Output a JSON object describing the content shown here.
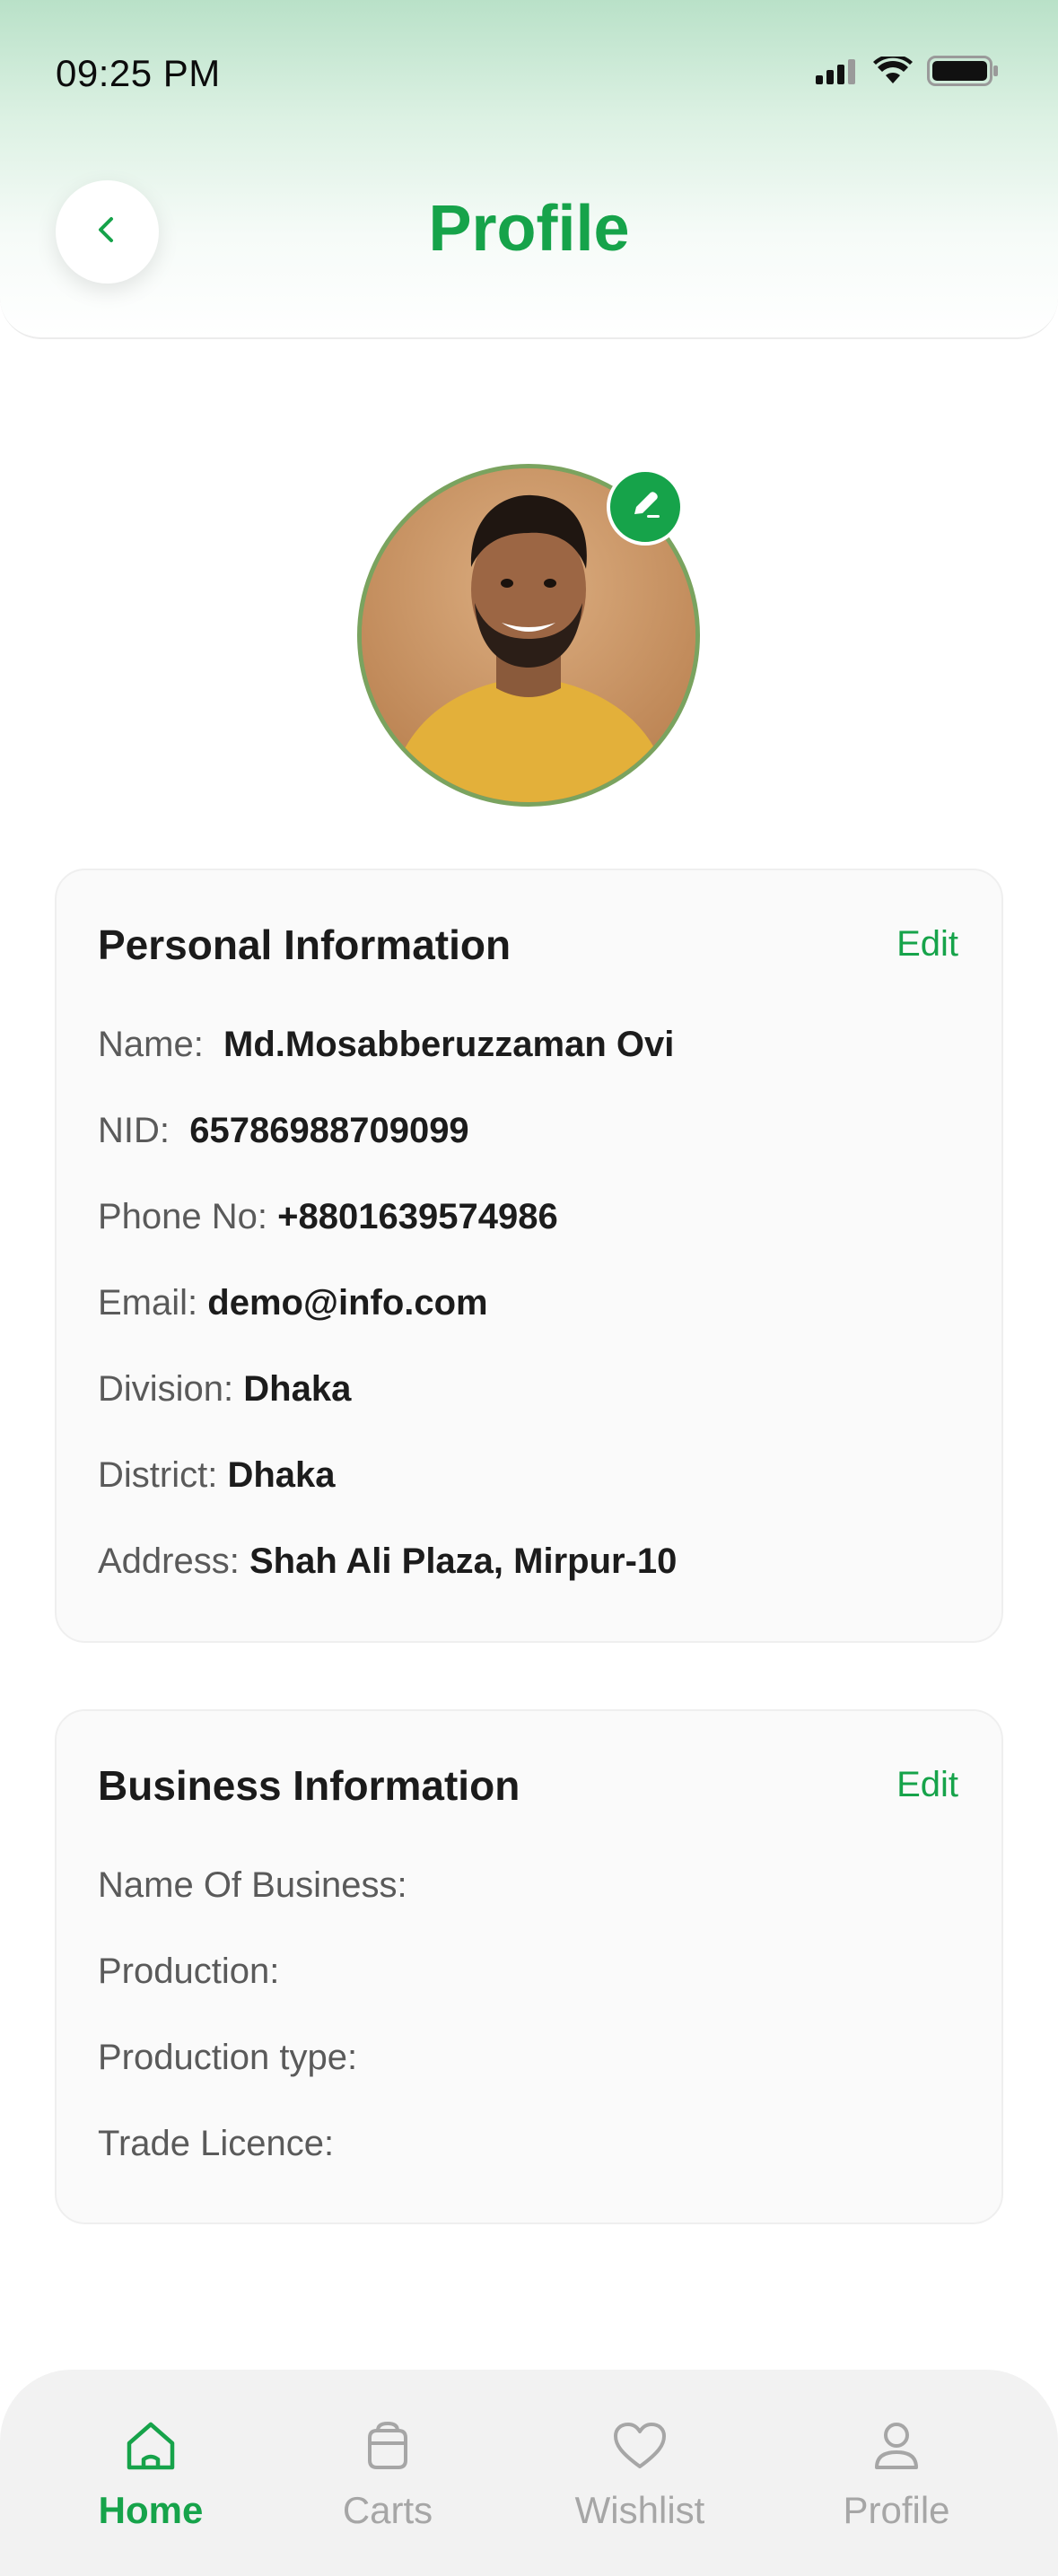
{
  "status_bar": {
    "time": "09:25 PM"
  },
  "header": {
    "title": "Profile",
    "back_icon": "chevron-left-icon"
  },
  "avatar": {
    "edit_icon": "pencil-icon"
  },
  "personal_info": {
    "title": "Personal Information",
    "edit_label": "Edit",
    "rows": [
      {
        "label": "Name:",
        "value": "Md.Mosabberuzzaman Ovi"
      },
      {
        "label": "NID:",
        "value": "65786988709099"
      },
      {
        "label": "Phone No:",
        "value": "+8801639574986"
      },
      {
        "label": "Email:",
        "value": "demo@info.com"
      },
      {
        "label": "Division:",
        "value": "Dhaka"
      },
      {
        "label": "District:",
        "value": "Dhaka"
      },
      {
        "label": "Address:",
        "value": "Shah Ali Plaza, Mirpur-10"
      }
    ]
  },
  "business_info": {
    "title": "Business Information",
    "edit_label": "Edit",
    "rows": [
      {
        "label": "Name Of Business:",
        "value": ""
      },
      {
        "label": "Production:",
        "value": ""
      },
      {
        "label": "Production type:",
        "value": ""
      },
      {
        "label": "Trade Licence:",
        "value": ""
      }
    ]
  },
  "bottom_nav": {
    "items": [
      {
        "label": "Home",
        "icon": "home-icon",
        "active": true
      },
      {
        "label": "Carts",
        "icon": "cart-icon",
        "active": false
      },
      {
        "label": "Wishlist",
        "icon": "heart-icon",
        "active": false
      },
      {
        "label": "Profile",
        "icon": "user-icon",
        "active": false
      }
    ]
  },
  "colors": {
    "accent": "#16a34a",
    "inactive": "#a6a6a6"
  }
}
